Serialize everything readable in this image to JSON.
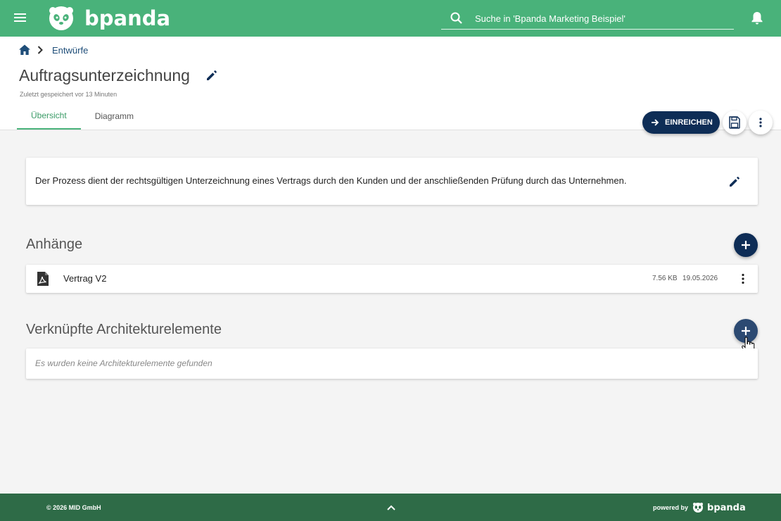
{
  "brand": {
    "name": "bpanda",
    "accent": "#49b27a",
    "primary": "#0e2d56",
    "footer_bg": "#2e6b47"
  },
  "search": {
    "placeholder": "Suche in 'Bpanda Marketing Beispiel'"
  },
  "breadcrumb": {
    "items": [
      "Entwürfe"
    ]
  },
  "page": {
    "title": "Auftragsunterzeichnung",
    "saved_info": "Zuletzt gespeichert vor 13 Minuten"
  },
  "tabs": [
    {
      "label": "Übersicht",
      "active": true
    },
    {
      "label": "Diagramm",
      "active": false
    }
  ],
  "actions": {
    "submit_label": "EINREICHEN"
  },
  "description": {
    "text": "Der Prozess dient der rechtsgültigen Unterzeichnung eines Vertrags durch den Kunden und der anschließenden Prüfung durch das Unternehmen."
  },
  "attachments": {
    "title": "Anhänge",
    "items": [
      {
        "name": "Vertrag V2",
        "size": "7.56 KB",
        "date": "19.05.2026",
        "icon": "pdf-icon"
      }
    ]
  },
  "architecture": {
    "title": "Verknüpfte Architekturelemente",
    "empty_text": "Es wurden keine Architekturelemente gefunden"
  },
  "footer": {
    "copyright": "© 2026 MID GmbH",
    "powered_by": "powered by",
    "powered_brand": "bpanda"
  }
}
